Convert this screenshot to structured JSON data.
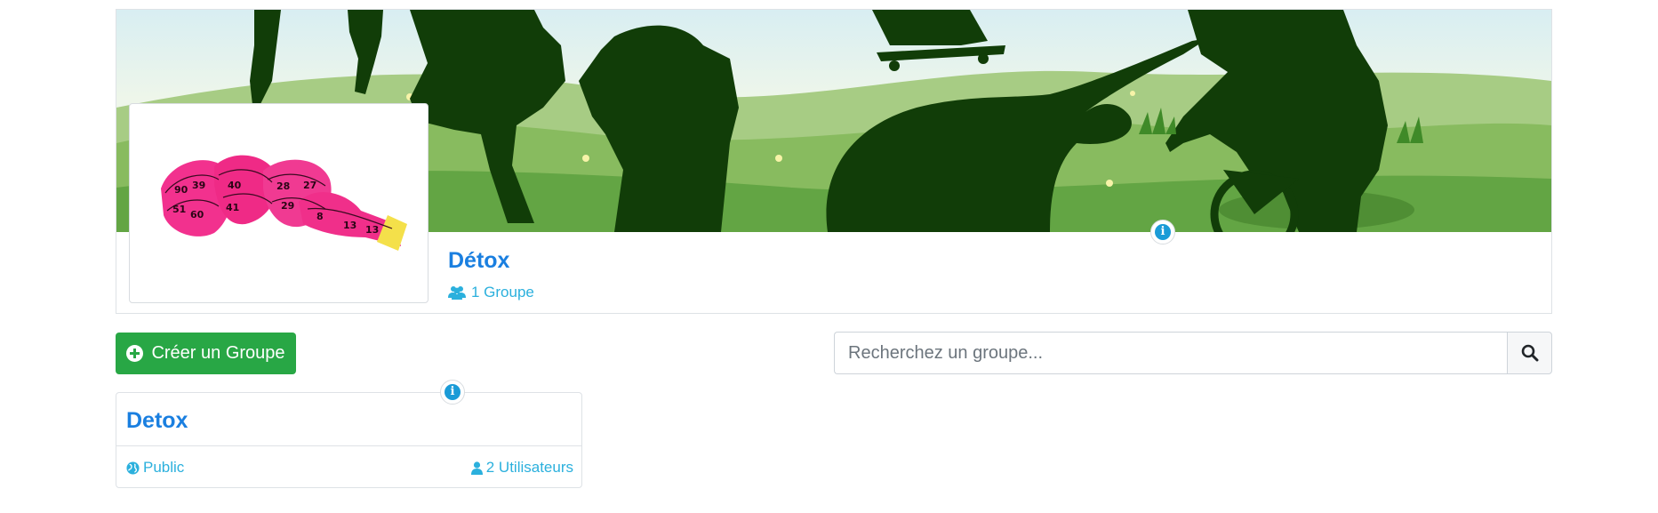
{
  "category": {
    "title": "Détox",
    "group_count": "1 Groupe",
    "banner_icon": "sports-silhouettes-banner",
    "thumbnail_icon": "pink-measuring-tape"
  },
  "toolbar": {
    "create_label": "Créer un Groupe",
    "search_placeholder": "Recherchez un groupe...",
    "search_value": ""
  },
  "groups": [
    {
      "title": "Detox",
      "visibility": "Public",
      "users": "2 Utilisateurs"
    }
  ],
  "colors": {
    "link_blue": "#1a7fe0",
    "info_cyan": "#2bb0dd",
    "success_green": "#28a745",
    "silhouette_green": "#113d08"
  }
}
